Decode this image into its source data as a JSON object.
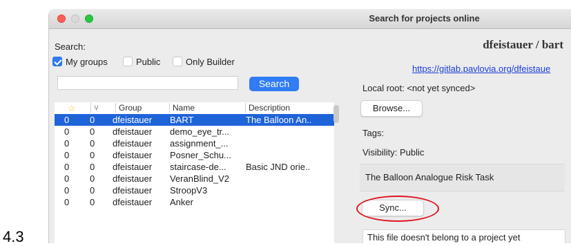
{
  "figure_number": "4.3",
  "window": {
    "title": "Search for projects online"
  },
  "search": {
    "label": "Search:",
    "filters": [
      {
        "label": "My groups",
        "checked": true
      },
      {
        "label": "Public",
        "checked": false
      },
      {
        "label": "Only Builder",
        "checked": false
      }
    ],
    "input_value": "",
    "button_label": "Search"
  },
  "table": {
    "columns": [
      "star-icon",
      "fork-icon",
      "Group",
      "Name",
      "Description"
    ],
    "header_labels": {
      "group": "Group",
      "name": "Name",
      "description": "Description"
    },
    "icons": {
      "star": "☆",
      "fork": "⑂"
    },
    "rows": [
      {
        "stars": "0",
        "forks": "0",
        "group": "dfeistauer",
        "name": "BART",
        "description": "The Balloon An..",
        "selected": true
      },
      {
        "stars": "0",
        "forks": "0",
        "group": "dfeistauer",
        "name": "demo_eye_tr...",
        "description": ""
      },
      {
        "stars": "0",
        "forks": "0",
        "group": "dfeistauer",
        "name": "assignment_...",
        "description": ""
      },
      {
        "stars": "0",
        "forks": "0",
        "group": "dfeistauer",
        "name": "Posner_Schu...",
        "description": ""
      },
      {
        "stars": "0",
        "forks": "0",
        "group": "dfeistauer",
        "name": "staircase-de...",
        "description": "Basic JND orie.."
      },
      {
        "stars": "0",
        "forks": "0",
        "group": "dfeistauer",
        "name": "VeranBlind_V2",
        "description": ""
      },
      {
        "stars": "0",
        "forks": "0",
        "group": "dfeistauer",
        "name": "StroopV3",
        "description": ""
      },
      {
        "stars": "0",
        "forks": "0",
        "group": "dfeistauer",
        "name": "Anker",
        "description": ""
      }
    ]
  },
  "details": {
    "title": "dfeistauer / bart",
    "url": "https://gitlab.pavlovia.org/dfeistaue",
    "local_root": "Local root: <not yet synced>",
    "browse_label": "Browse...",
    "tags_label": "Tags:",
    "visibility": "Visibility: Public",
    "description": "The Balloon Analogue Risk Task",
    "sync_label": "Sync...",
    "message": "This file doesn't belong to a project yet"
  },
  "colors": {
    "accent": "#2f7cf6",
    "selection": "#1f63d9",
    "annotation": "#e0141e",
    "link": "#1a3bd8"
  }
}
